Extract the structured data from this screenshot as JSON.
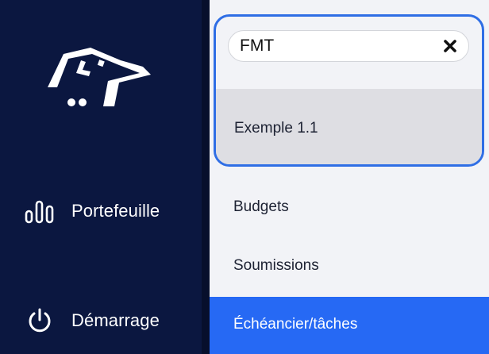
{
  "sidebar": {
    "logo_icon": "dog-head-logo-icon",
    "items": [
      {
        "label": "Portefeuille",
        "icon": "bar-chart-icon"
      },
      {
        "label": "Démarrage",
        "icon": "power-icon"
      }
    ]
  },
  "panel": {
    "search": {
      "value": "FMT",
      "clear_icon": "close-icon"
    },
    "selected_result": {
      "label": "Exemple 1.1"
    },
    "items": [
      {
        "label": "Budgets"
      },
      {
        "label": "Soumissions"
      },
      {
        "label": "Échéancier/tâches"
      }
    ]
  },
  "colors": {
    "sidebar_bg": "#0b1740",
    "panel_bg": "#f2f3f7",
    "accent": "#2669f4",
    "highlight_border": "#2f6ee5",
    "selected_bg": "#dedee3"
  }
}
